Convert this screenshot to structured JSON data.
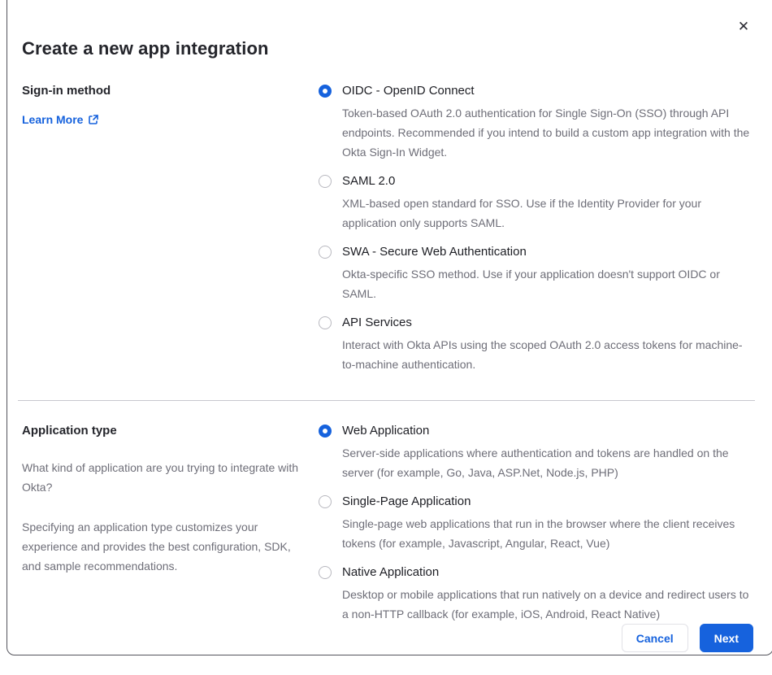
{
  "modal": {
    "title": "Create a new app integration",
    "close_icon": "✕"
  },
  "signin_section": {
    "label": "Sign-in method",
    "learn_more_label": "Learn More",
    "options": [
      {
        "label": "OIDC - OpenID Connect",
        "description": "Token-based OAuth 2.0 authentication for Single Sign-On (SSO) through API endpoints. Recommended if you intend to build a custom app integration with the Okta Sign-In Widget.",
        "selected": true
      },
      {
        "label": "SAML 2.0",
        "description": "XML-based open standard for SSO. Use if the Identity Provider for your application only supports SAML.",
        "selected": false
      },
      {
        "label": "SWA - Secure Web Authentication",
        "description": "Okta-specific SSO method. Use if your application doesn't support OIDC or SAML.",
        "selected": false
      },
      {
        "label": "API Services",
        "description": "Interact with Okta APIs using the scoped OAuth 2.0 access tokens for machine-to-machine authentication.",
        "selected": false
      }
    ]
  },
  "apptype_section": {
    "label": "Application type",
    "paragraph1": "What kind of application are you trying to integrate with Okta?",
    "paragraph2": "Specifying an application type customizes your experience and provides the best configuration, SDK, and sample recommendations.",
    "options": [
      {
        "label": "Web Application",
        "description": "Server-side applications where authentication and tokens are handled on the server (for example, Go, Java, ASP.Net, Node.js, PHP)",
        "selected": true
      },
      {
        "label": "Single-Page Application",
        "description": "Single-page web applications that run in the browser where the client receives tokens (for example, Javascript, Angular, React, Vue)",
        "selected": false
      },
      {
        "label": "Native Application",
        "description": "Desktop or mobile applications that run natively on a device and redirect users to a non-HTTP callback (for example, iOS, Android, React Native)",
        "selected": false
      }
    ]
  },
  "footer": {
    "cancel_label": "Cancel",
    "next_label": "Next"
  },
  "colors": {
    "accent_blue": "#1662dd",
    "text_dark": "#1d1e24",
    "text_gray": "#6e6e78",
    "divider_gray": "#c8c8ce"
  }
}
